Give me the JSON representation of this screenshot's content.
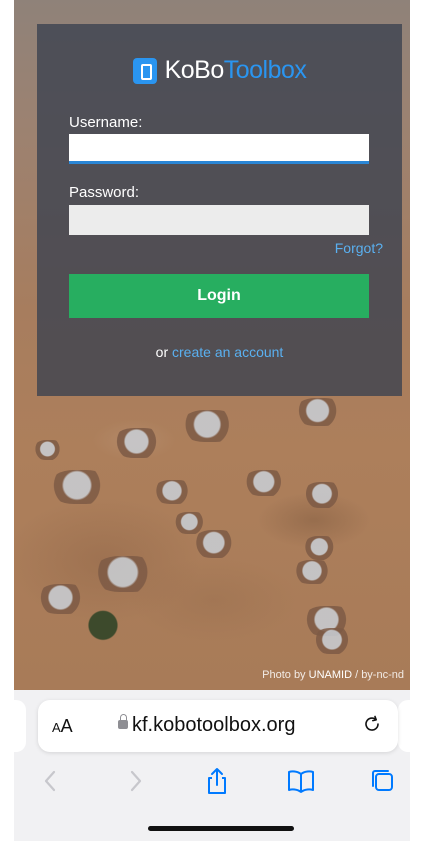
{
  "logo": {
    "part1": "KoBo",
    "part2": "Toolbox"
  },
  "login": {
    "username_label": "Username:",
    "username_value": "",
    "password_label": "Password:",
    "password_value": "",
    "forgot_link": "Forgot?",
    "login_button": "Login",
    "signup_prefix": "or",
    "signup_link": "create an account"
  },
  "photo_credit": {
    "prefix": "Photo by",
    "author": "UNAMID",
    "license": "/ by-nc-nd"
  },
  "browser": {
    "text_size_label_small": "A",
    "text_size_label_large": "A",
    "url": "kf.kobotoolbox.org",
    "icons": [
      "lock-icon",
      "reload-icon",
      "back-icon",
      "forward-icon",
      "share-icon",
      "bookmarks-icon",
      "tabs-icon"
    ]
  },
  "colors": {
    "brand_blue": "#2a95f0",
    "login_green": "#27ae60",
    "link_blue": "#5ab0f0",
    "ios_blue": "#007aff"
  }
}
